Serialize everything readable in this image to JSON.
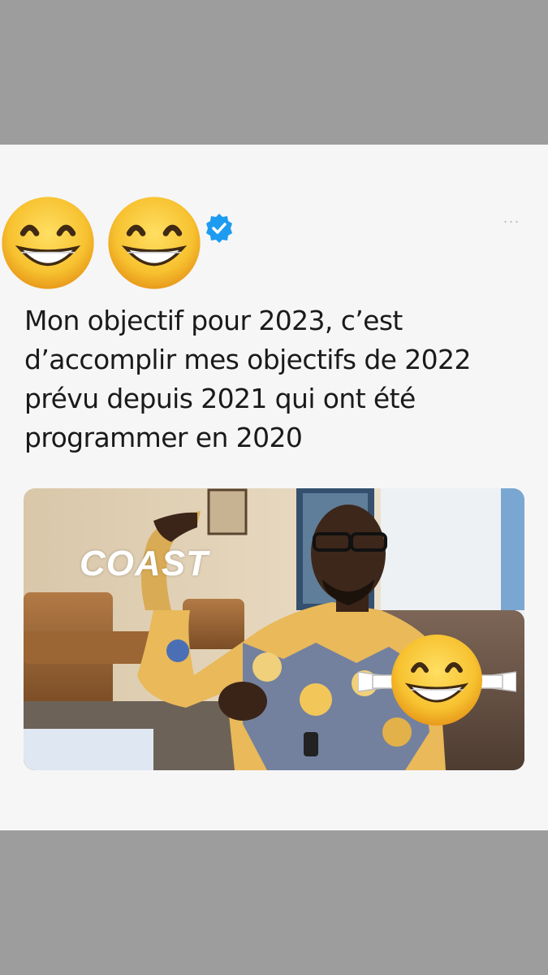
{
  "tweet": {
    "author": {
      "avatar_icons": [
        "grinning-squinting-face-icon",
        "grinning-squinting-face-icon"
      ],
      "verified_badge": "verified-badge-icon",
      "verified_color": "#1d9bf0"
    },
    "more_icon": "ellipsis-icon",
    "more_glyph": "···",
    "text": "Mon objectif pour 2023, c’est\nd’accomplir mes objectifs de 2022\nprévu depuis 2021 qui ont été\nprogrammer en 2020",
    "media": {
      "watermark": "COAST",
      "overlay_sticker": "grinning-squinting-face-icon"
    }
  },
  "colors": {
    "frame_gray": "#9d9d9d",
    "card_background": "#f6f6f7",
    "text": "#1a1a1a",
    "emoji_yellow": "#f9c23c"
  }
}
